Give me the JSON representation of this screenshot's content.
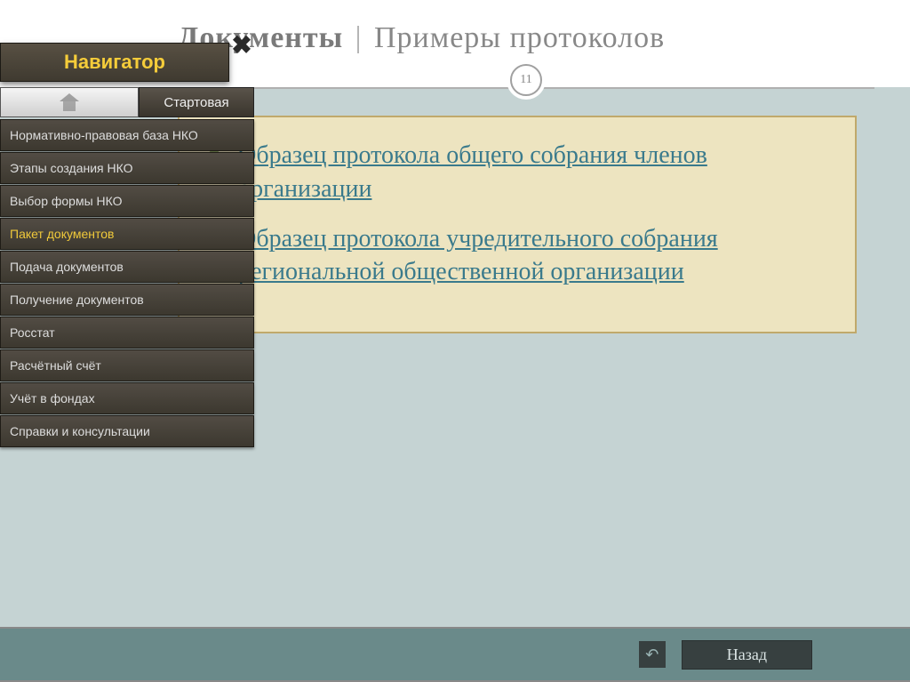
{
  "header": {
    "title_bold": "Документы",
    "title_sep": "|",
    "title_rest": "Примеры протоколов",
    "page_number": "11"
  },
  "content": {
    "items": [
      "Образец протокола общего собрания членов организации",
      "Образец протокола учредительного собрания региональной общественной организации"
    ]
  },
  "footer": {
    "back_label": "Назад",
    "undo_icon": "↶"
  },
  "navigator": {
    "title": "Навигатор",
    "close_glyph": "✖",
    "home_label": "Стартовая",
    "items": [
      {
        "label": "Нормативно-правовая база НКО",
        "active": false
      },
      {
        "label": "Этапы создания НКО",
        "active": false
      },
      {
        "label": "Выбор формы НКО",
        "active": false
      },
      {
        "label": "Пакет документов",
        "active": true
      },
      {
        "label": "Подача документов",
        "active": false
      },
      {
        "label": "Получение документов",
        "active": false
      },
      {
        "label": "Росстат",
        "active": false
      },
      {
        "label": "Расчётный счёт",
        "active": false
      },
      {
        "label": "Учёт в фондах",
        "active": false
      },
      {
        "label": "Справки и консультации",
        "active": false
      }
    ]
  }
}
